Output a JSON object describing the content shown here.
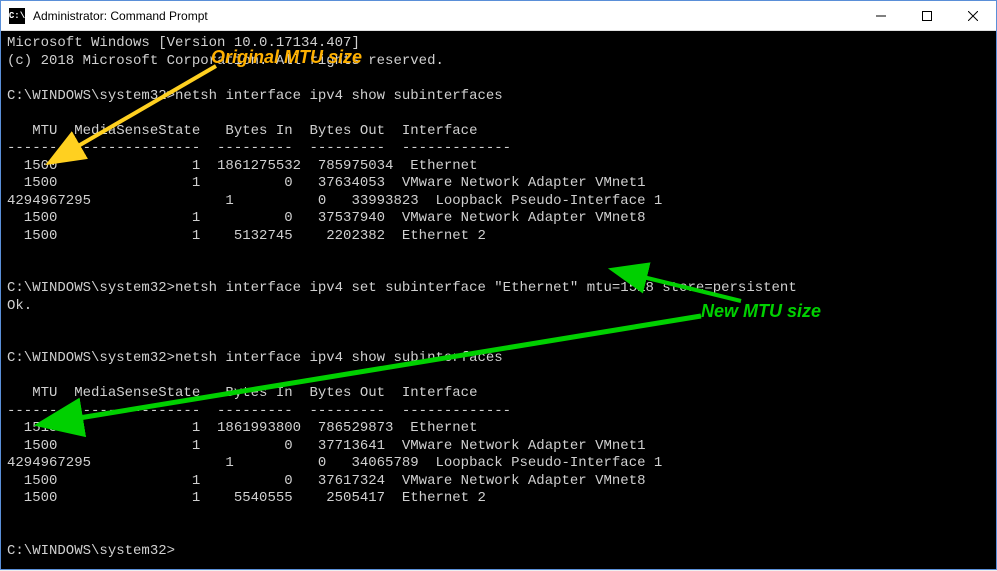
{
  "window": {
    "title": "Administrator: Command Prompt",
    "icon_label": "C:\\"
  },
  "annotations": {
    "original_label": "Original MTU size",
    "new_label": "New MTU size"
  },
  "terminal": {
    "header_line1": "Microsoft Windows [Version 10.0.17134.407]",
    "header_line2": "(c) 2018 Microsoft Corporation. All rights reserved.",
    "prompt": "C:\\WINDOWS\\system32>",
    "cmd_show": "netsh interface ipv4 show subinterfaces",
    "cmd_set": "netsh interface ipv4 set subinterface \"Ethernet\" mtu=1518 store=persistent",
    "ok": "Ok.",
    "col_header": "   MTU  MediaSenseState   Bytes In  Bytes Out  Interface",
    "col_divider": "------  ---------------  ---------  ---------  -------------",
    "table1": [
      "  1500                1  1861275532  785975034  Ethernet",
      "  1500                1          0   37634053  VMware Network Adapter VMnet1",
      "4294967295                1          0   33993823  Loopback Pseudo-Interface 1",
      "  1500                1          0   37537940  VMware Network Adapter VMnet8",
      "  1500                1    5132745    2202382  Ethernet 2"
    ],
    "table2": [
      "  1518                1  1861993800  786529873  Ethernet",
      "  1500                1          0   37713641  VMware Network Adapter VMnet1",
      "4294967295                1          0   34065789  Loopback Pseudo-Interface 1",
      "  1500                1          0   37617324  VMware Network Adapter VMnet8",
      "  1500                1    5540555    2505417  Ethernet 2"
    ]
  }
}
